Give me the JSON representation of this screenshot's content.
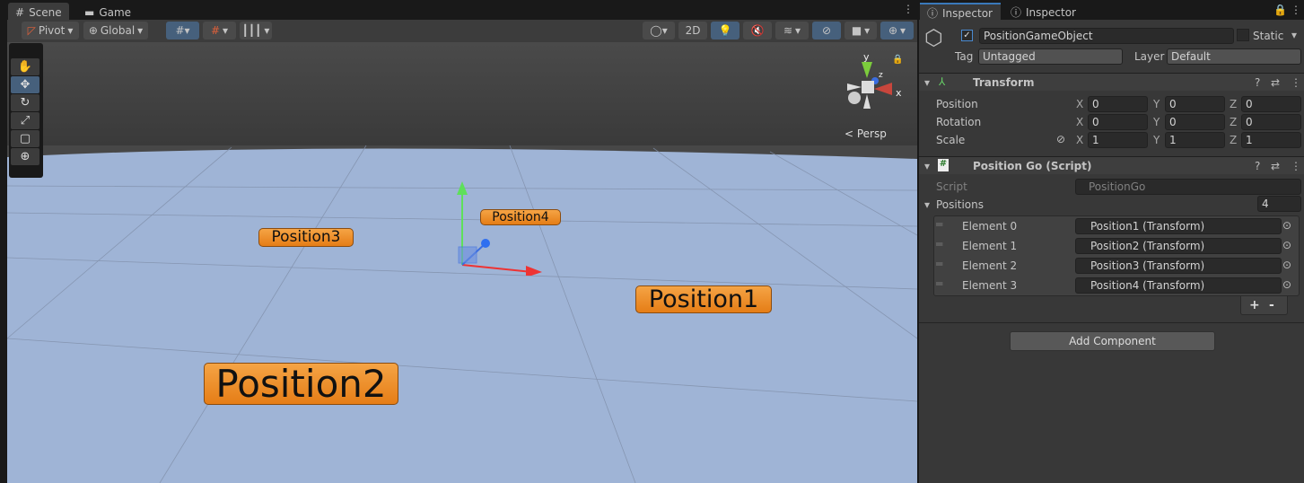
{
  "scene_tabs": [
    {
      "label": "Scene",
      "icon": "grid-hash-icon"
    },
    {
      "label": "Game",
      "icon": "gamepad-icon"
    }
  ],
  "toolbar": {
    "pivot": "Pivot",
    "global": "Global",
    "mode_2d": "2D"
  },
  "scene": {
    "persp": "< Persp",
    "gizmo_axes": {
      "x": "x",
      "y": "y",
      "z": "z"
    },
    "labels": [
      "Position1",
      "Position2",
      "Position3",
      "Position4"
    ]
  },
  "inspector": {
    "tabs": [
      "Inspector",
      "Inspector"
    ],
    "object_name": "PositionGameObject",
    "active": true,
    "static_label": "Static",
    "static": false,
    "tag_label": "Tag",
    "tag": "Untagged",
    "layer_label": "Layer",
    "layer": "Default",
    "transform": {
      "title": "Transform",
      "rows": [
        {
          "label": "Position",
          "x": "0",
          "y": "0",
          "z": "0"
        },
        {
          "label": "Rotation",
          "x": "0",
          "y": "0",
          "z": "0"
        },
        {
          "label": "Scale",
          "x": "1",
          "y": "1",
          "z": "1"
        }
      ]
    },
    "script_component": {
      "title": "Position Go (Script)",
      "script_label": "Script",
      "script_value": "PositionGo",
      "list_label": "Positions",
      "count": "4",
      "elements": [
        {
          "label": "Element 0",
          "value": "Position1 (Transform)"
        },
        {
          "label": "Element 1",
          "value": "Position2 (Transform)"
        },
        {
          "label": "Element 2",
          "value": "Position3 (Transform)"
        },
        {
          "label": "Element 3",
          "value": "Position4 (Transform)"
        }
      ],
      "add": "+",
      "remove": "-"
    },
    "add_component": "Add Component"
  },
  "colors": {
    "accent": "#46607c",
    "label_orange": "#f0952f",
    "floor": "#9fb4d6"
  }
}
